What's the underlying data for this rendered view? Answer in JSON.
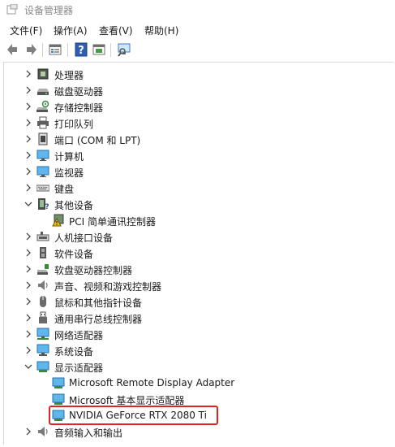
{
  "window": {
    "title": "设备管理器"
  },
  "menu": [
    {
      "label": "文件(F)"
    },
    {
      "label": "操作(A)"
    },
    {
      "label": "查看(V)"
    },
    {
      "label": "帮助(H)"
    }
  ],
  "toolbar": [
    "back-icon",
    "forward-icon",
    "properties-icon",
    "help-icon",
    "view-icon",
    "scan-hardware-icon"
  ],
  "tree": [
    {
      "label": "处理器",
      "level": 0,
      "expanded": false,
      "icon": "processor-icon"
    },
    {
      "label": "磁盘驱动器",
      "level": 0,
      "expanded": false,
      "icon": "disk-drive-icon"
    },
    {
      "label": "存储控制器",
      "level": 0,
      "expanded": false,
      "icon": "storage-controller-icon"
    },
    {
      "label": "打印队列",
      "level": 0,
      "expanded": false,
      "icon": "printer-icon"
    },
    {
      "label": "端口 (COM 和 LPT)",
      "level": 0,
      "expanded": false,
      "icon": "port-icon"
    },
    {
      "label": "计算机",
      "level": 0,
      "expanded": false,
      "icon": "computer-icon"
    },
    {
      "label": "监视器",
      "level": 0,
      "expanded": false,
      "icon": "monitor-icon"
    },
    {
      "label": "键盘",
      "level": 0,
      "expanded": false,
      "icon": "keyboard-icon"
    },
    {
      "label": "其他设备",
      "level": 0,
      "expanded": true,
      "icon": "other-devices-icon"
    },
    {
      "label": "PCI 简单通讯控制器",
      "level": 1,
      "icon": "warning-device-icon"
    },
    {
      "label": "人机接口设备",
      "level": 0,
      "expanded": false,
      "icon": "hid-icon"
    },
    {
      "label": "软件设备",
      "level": 0,
      "expanded": false,
      "icon": "software-device-icon"
    },
    {
      "label": "软盘驱动器控制器",
      "level": 0,
      "expanded": false,
      "icon": "floppy-controller-icon"
    },
    {
      "label": "声音、视频和游戏控制器",
      "level": 0,
      "expanded": false,
      "icon": "sound-icon"
    },
    {
      "label": "鼠标和其他指针设备",
      "level": 0,
      "expanded": false,
      "icon": "mouse-icon"
    },
    {
      "label": "通用串行总线控制器",
      "level": 0,
      "expanded": false,
      "icon": "usb-icon"
    },
    {
      "label": "网络适配器",
      "level": 0,
      "expanded": false,
      "icon": "network-icon"
    },
    {
      "label": "系统设备",
      "level": 0,
      "expanded": false,
      "icon": "system-device-icon"
    },
    {
      "label": "显示适配器",
      "level": 0,
      "expanded": true,
      "icon": "display-adapter-icon"
    },
    {
      "label": "Microsoft Remote Display Adapter",
      "level": 1,
      "icon": "display-card-icon"
    },
    {
      "label": "Microsoft 基本显示适配器",
      "level": 1,
      "icon": "display-card-icon"
    },
    {
      "label": "NVIDIA GeForce RTX 2080 Ti",
      "level": 1,
      "icon": "display-card-icon",
      "highlighted": true
    },
    {
      "label": "音频输入和输出",
      "level": 0,
      "expanded": false,
      "icon": "audio-io-icon"
    }
  ],
  "colors": {
    "highlight_border": "#e02424"
  }
}
